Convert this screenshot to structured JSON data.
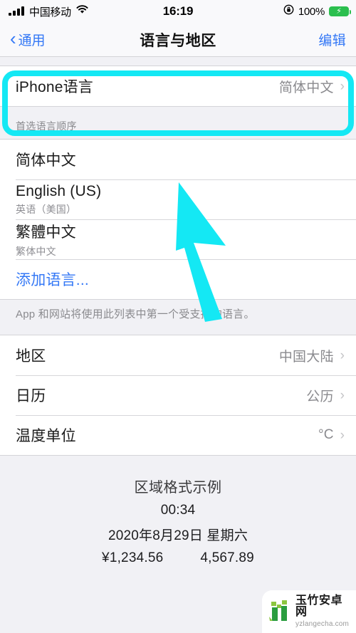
{
  "status_bar": {
    "carrier": "中国移动",
    "signal_icon": "signal-bars-icon",
    "wifi_icon": "wifi-icon",
    "time": "16:19",
    "rotation_lock_icon": "rotation-lock-icon",
    "battery_percent": "100%",
    "battery_icon": "battery-charging-icon"
  },
  "nav": {
    "back_label": "通用",
    "back_icon": "chevron-left-icon",
    "title": "语言与地区",
    "edit_label": "编辑"
  },
  "language_row": {
    "label": "iPhone语言",
    "value": "简体中文",
    "chevron": "›"
  },
  "preferred": {
    "header": "首选语言顺序",
    "items": [
      {
        "title": "简体中文",
        "subtitle": ""
      },
      {
        "title": "English (US)",
        "subtitle": "英语（美国）"
      },
      {
        "title": "繁體中文",
        "subtitle": "繁体中文"
      }
    ],
    "add_label": "添加语言...",
    "footer": "App 和网站将使用此列表中第一个受支持的语言。"
  },
  "region_settings": {
    "rows": [
      {
        "label": "地区",
        "value": "中国大陆",
        "chevron": "›"
      },
      {
        "label": "日历",
        "value": "公历",
        "chevron": "›"
      },
      {
        "label": "温度单位",
        "value": "°C",
        "chevron": "›"
      }
    ]
  },
  "sample": {
    "title": "区域格式示例",
    "time": "00:34",
    "date": "2020年8月29日 星期六",
    "currency": "¥1,234.56",
    "number": "4,567.89"
  },
  "annotations": {
    "highlight_color": "#14e8f4",
    "cursor_color": "#14e8f4",
    "highlight_target": "iPhone语言",
    "cursor_icon": "arrow-cursor-annotation"
  },
  "watermark": {
    "name": "玉竹安卓网",
    "url": "yzlangecha.com",
    "logo_icon": "bamboo-logo-icon"
  }
}
